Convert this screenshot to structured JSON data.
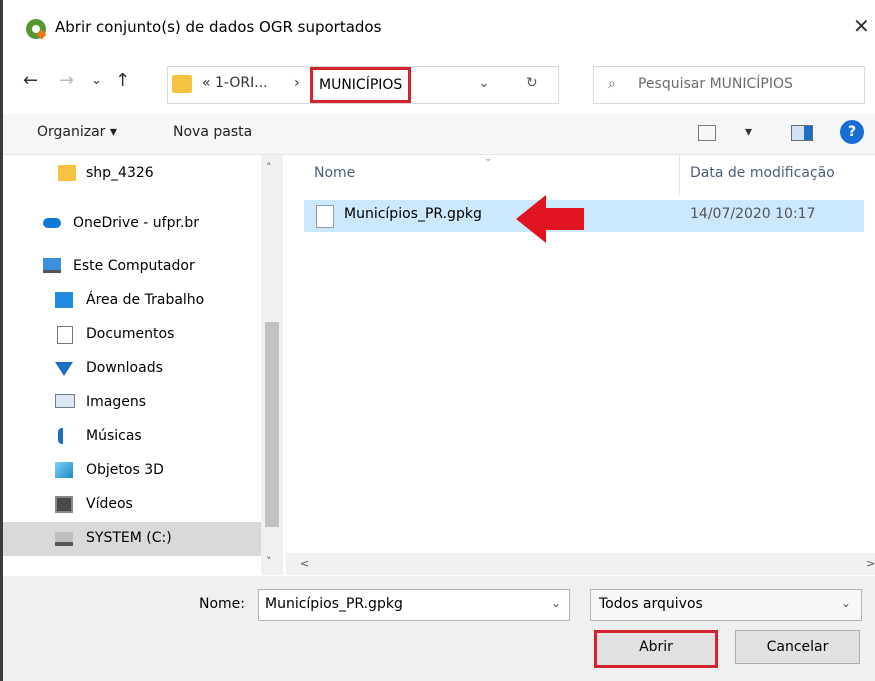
{
  "window": {
    "title": "Abrir conjunto(s) de dados OGR suportados",
    "close_glyph": "✕",
    "app_icon": "qgis-icon"
  },
  "nav": {
    "back": "←",
    "forward": "→",
    "recent": "⌄",
    "up": "↑",
    "crumb_parent": "« 1-ORI...",
    "crumb_separator": "›",
    "crumb_current": "MUNICÍPIOS",
    "address_drop": "⌄",
    "refresh": "↻",
    "search_placeholder": "Pesquisar MUNICÍPIOS",
    "search_icon": "⌕"
  },
  "toolbar": {
    "organize": "Organizar ▾",
    "new_folder": "Nova pasta",
    "view_drop": "▾",
    "help": "?"
  },
  "sidebar": {
    "items": [
      {
        "label": "shp_4326",
        "icon": "folder-icon"
      },
      {
        "label": "OneDrive - ufpr.br",
        "icon": "cloud-icon"
      },
      {
        "label": "Este Computador",
        "icon": "computer-icon"
      },
      {
        "label": "Área de Trabalho",
        "icon": "desktop-icon"
      },
      {
        "label": "Documentos",
        "icon": "documents-icon"
      },
      {
        "label": "Downloads",
        "icon": "downloads-icon"
      },
      {
        "label": "Imagens",
        "icon": "pictures-icon"
      },
      {
        "label": "Músicas",
        "icon": "music-icon"
      },
      {
        "label": "Objetos 3D",
        "icon": "objects-3d-icon"
      },
      {
        "label": "Vídeos",
        "icon": "videos-icon"
      },
      {
        "label": "SYSTEM (C:)",
        "icon": "drive-icon"
      }
    ],
    "scroll_up": "˄",
    "scroll_down": "˅"
  },
  "list": {
    "columns": {
      "name": "Nome",
      "modified": "Data de modificação"
    },
    "files": [
      {
        "name": "Municípios_PR.gpkg",
        "modified": "14/07/2020 10:17"
      }
    ],
    "scroll_left": "<",
    "scroll_right": ">"
  },
  "footer": {
    "filename_label": "Nome:",
    "filename_value": "Municípios_PR.gpkg",
    "dropdown_glyph": "⌄",
    "filetype_value": "Todos arquivos",
    "open_label": "Abrir",
    "cancel_label": "Cancelar"
  },
  "colors": {
    "highlight_red": "#d3232c",
    "selection_blue": "#cce8ff",
    "folder_yellow": "#f5c242"
  }
}
